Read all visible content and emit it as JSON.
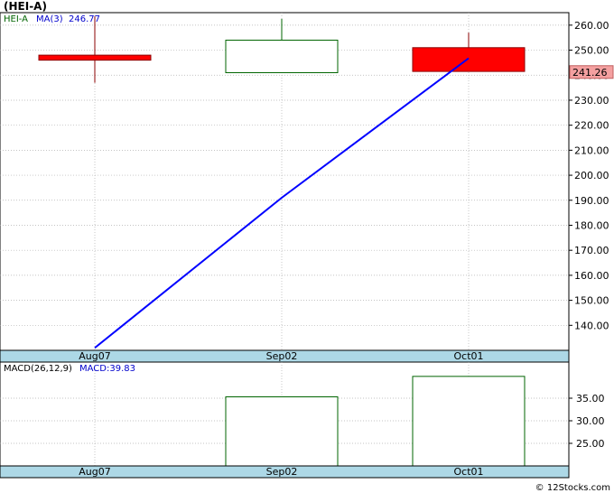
{
  "chart_data": [
    {
      "type": "candlestick",
      "title": "(HEI-A)",
      "symbol_label": "HEI-A",
      "ma_label": "MA(3)",
      "ma_value": "246.77",
      "last_price": "241.26",
      "ylim": [
        130,
        265
      ],
      "y_ticks": [
        140,
        150,
        160,
        170,
        180,
        190,
        200,
        210,
        220,
        230,
        240,
        250,
        260
      ],
      "y_tick_labels": [
        "140.00",
        "150.00",
        "160.00",
        "170.00",
        "180.00",
        "190.00",
        "200.00",
        "210.00",
        "220.00",
        "230.00",
        "240.00",
        "250.00",
        "260.00"
      ],
      "categories": [
        "Aug07",
        "Sep02",
        "Oct01"
      ],
      "candles": [
        {
          "open": 248.0,
          "high": 263.5,
          "low": 237.0,
          "close": 246.0
        },
        {
          "open": 241.0,
          "high": 262.5,
          "low": 241.0,
          "close": 254.0
        },
        {
          "open": 251.0,
          "high": 257.0,
          "low": 241.5,
          "close": 241.5
        }
      ],
      "ma_series": {
        "name": "MA(3)",
        "values": [
          131,
          191,
          246.77
        ]
      },
      "colors": {
        "up_border": "#006400",
        "down_fill": "#ff0000",
        "down_border": "#8b0000",
        "ma_line": "#0000ff",
        "grid": "#b0b0b0",
        "axis_band": "#add8e6",
        "price_box": "#f4a0a0"
      }
    },
    {
      "type": "bar",
      "title": "MACD(26,12,9)",
      "macd_label": "MACD:39.83",
      "ylim": [
        20,
        43
      ],
      "y_ticks": [
        25,
        30,
        35
      ],
      "y_tick_labels": [
        "25.00",
        "30.00",
        "35.00"
      ],
      "categories": [
        "Aug07",
        "Sep02",
        "Oct01"
      ],
      "values": [
        null,
        35.3,
        39.83
      ]
    }
  ],
  "footer": {
    "credit": "© 12Stocks.com"
  }
}
